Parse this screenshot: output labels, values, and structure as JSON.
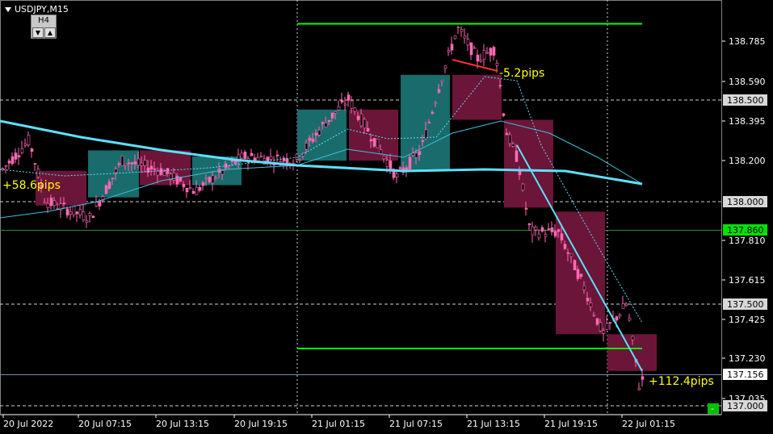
{
  "header": {
    "symbol": "USDJPY,M15",
    "timeframe_label": "H4",
    "down_label": "▼",
    "up_label": "▲"
  },
  "colors": {
    "background": "#000000",
    "bull_box": "#1a6b6b",
    "bear_box": "#6b1538",
    "candle": "#ff69b4",
    "ma_thick": "#5ce1ff",
    "ma_thin": "#3fc0d8",
    "level_line": "#00ff00",
    "trend_line": "#5ce1ff",
    "pips_text": "#ffff00"
  },
  "price_axis": {
    "ticks": [
      "138.785",
      "138.590",
      "138.395",
      "138.200",
      "137.810",
      "137.615",
      "137.425",
      "137.230",
      "137.035"
    ],
    "tagged_levels": [
      {
        "label": "138.500",
        "style": "dashed-white"
      },
      {
        "label": "138.000",
        "style": "dashed-white"
      },
      {
        "label": "137.860",
        "style": "green-solid"
      },
      {
        "label": "137.500",
        "style": "dashed-white"
      },
      {
        "label": "137.156",
        "style": "bid"
      },
      {
        "label": "137.000",
        "style": "dashed-white"
      }
    ],
    "close_button": "-"
  },
  "time_axis": {
    "labels": [
      "20 Jul 2022",
      "20 Jul 07:15",
      "20 Jul 13:15",
      "20 Jul 19:15",
      "21 Jul 01:15",
      "21 Jul 07:15",
      "21 Jul 13:15",
      "21 Jul 19:15",
      "22 Jul 01:15"
    ]
  },
  "annotations": {
    "pips_left": "+58.6pips",
    "pips_top": "-5.2pips",
    "pips_bottom": "+112.4pips"
  },
  "chart_data": {
    "type": "candlestick",
    "symbol": "USDJPY",
    "timeframe": "M15",
    "price_range": [
      136.98,
      138.92
    ],
    "price_ticks": [
      138.785,
      138.59,
      138.395,
      138.2,
      137.81,
      137.615,
      137.425,
      137.23,
      137.035
    ],
    "horizontal_levels": [
      138.5,
      138.0,
      137.86,
      137.5,
      137.156,
      137.0
    ],
    "h4_boxes": [
      {
        "direction": "bear",
        "open": 138.15,
        "close": 137.98
      },
      {
        "direction": "bull",
        "open": 138.02,
        "close": 138.25
      },
      {
        "direction": "bear",
        "open": 138.25,
        "close": 138.08
      },
      {
        "direction": "bull",
        "open": 138.08,
        "close": 138.22
      },
      {
        "direction": "bull",
        "open": 138.2,
        "close": 138.45
      },
      {
        "direction": "bear",
        "open": 138.45,
        "close": 138.2
      },
      {
        "direction": "bull",
        "open": 138.15,
        "close": 138.62
      },
      {
        "direction": "bear",
        "open": 138.62,
        "close": 138.4
      },
      {
        "direction": "bear",
        "open": 138.4,
        "close": 137.97
      },
      {
        "direction": "bear",
        "open": 137.95,
        "close": 137.35
      },
      {
        "direction": "bear",
        "open": 137.35,
        "close": 137.17
      }
    ],
    "pips_labels": [
      "+58.6pips",
      "-5.2pips",
      "+112.4pips"
    ]
  }
}
